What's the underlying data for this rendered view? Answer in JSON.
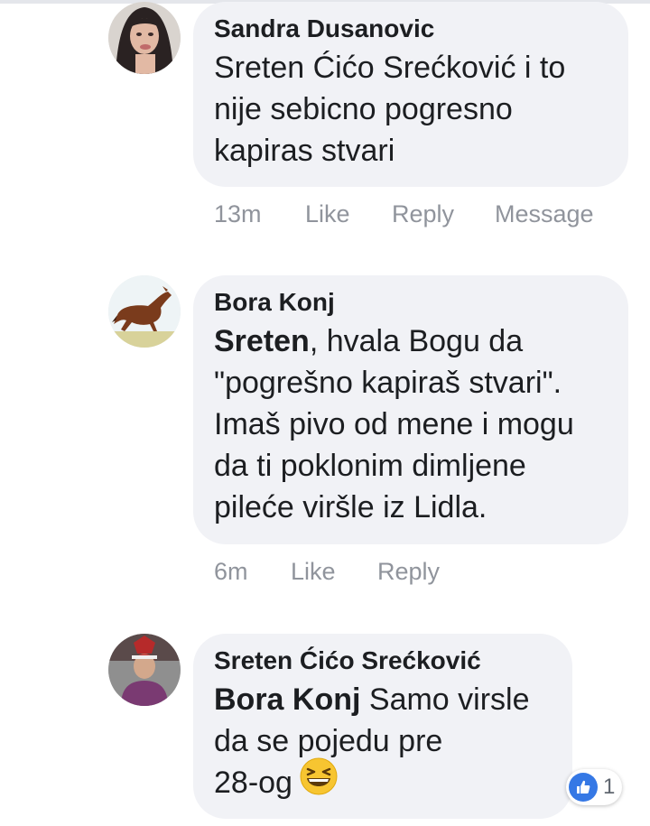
{
  "comments": [
    {
      "author": "Sandra Dusanovic",
      "text": "Sreten Ćićo Srećković i to\nnije sebicno pogresno\nkapiras stvari",
      "time": "13m",
      "like": "Like",
      "reply": "Reply",
      "message": "Message"
    },
    {
      "author": "Bora Konj",
      "mention": "Sreten",
      "text": ", hvala Bogu da\n\"pogrešno kapiraš stvari\".\nImaš pivo od mene i mogu\nda ti poklonim dimljene\npileće viršle iz Lidla.",
      "time": "6m",
      "like": "Like",
      "reply": "Reply"
    },
    {
      "author": "Sreten Ćićo Srećković",
      "mention": "Bora Konj",
      "text": " Samo virsle\nda se pojedu pre\n28-og",
      "reaction_count": "1"
    }
  ],
  "icons": {
    "emoji": "grinning-squinting-face-icon",
    "reaction": "like-thumb-icon"
  },
  "colors": {
    "bubble": "#f1f2f6",
    "text": "#1c1e21",
    "meta": "#90949c",
    "like_blue": "#3578e5",
    "emoji_yellow": "#f7c531"
  }
}
